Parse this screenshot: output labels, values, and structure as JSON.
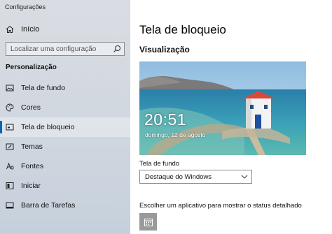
{
  "window": {
    "title": "Configurações"
  },
  "sidebar": {
    "home_label": "Início",
    "search_placeholder": "Localizar uma configuração",
    "section_label": "Personalização",
    "items": [
      {
        "label": "Tela de fundo",
        "icon": "picture-icon"
      },
      {
        "label": "Cores",
        "icon": "palette-icon"
      },
      {
        "label": "Tela de bloqueio",
        "icon": "lock-screen-icon",
        "selected": true
      },
      {
        "label": "Temas",
        "icon": "brush-icon"
      },
      {
        "label": "Fontes",
        "icon": "font-icon"
      },
      {
        "label": "Iniciar",
        "icon": "start-icon"
      },
      {
        "label": "Barra de Tarefas",
        "icon": "taskbar-icon"
      }
    ]
  },
  "main": {
    "page_title": "Tela de bloqueio",
    "preview_heading": "Visualização",
    "preview": {
      "time": "20:51",
      "date": "domingo, 12 de agosto"
    },
    "background_label": "Tela de fundo",
    "background_value": "Destaque do Windows",
    "app_status_label": "Escolher um aplicativo para mostrar o status detalhado",
    "app_button_icon": "calendar-icon"
  },
  "colors": {
    "accent": "#0a62b8",
    "sidebar_bg": "#d5dae1",
    "app_button_bg": "#9a9a9a"
  }
}
